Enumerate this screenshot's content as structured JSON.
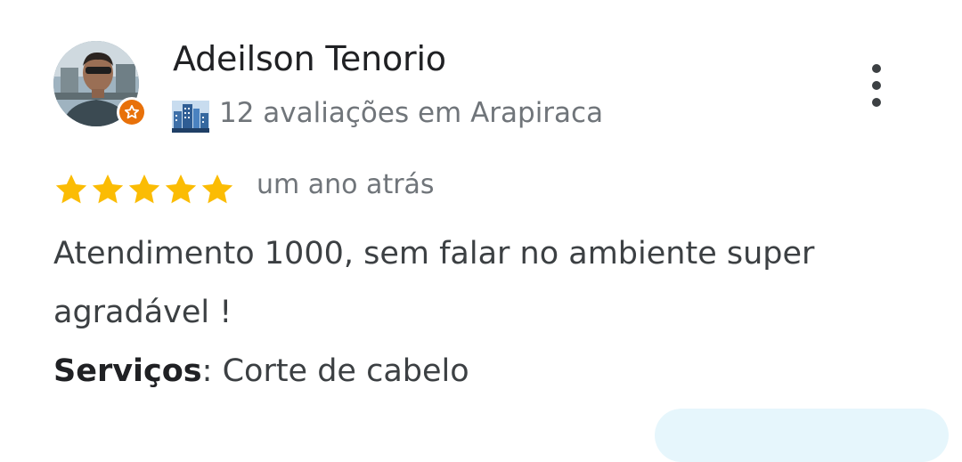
{
  "reviewer": {
    "name": "Adeilson Tenorio",
    "avatar_icon": "profile-photo",
    "badge_icon": "local-guide-star-icon",
    "badge_color": "#e8710a",
    "level_icon": "city-buildings-icon",
    "reviews_summary": "12 avaliações em Arapiraca"
  },
  "menu": {
    "icon": "more-vert-icon"
  },
  "review": {
    "rating": 5,
    "rating_max": 5,
    "star_color": "#fbbc04",
    "date": "um ano atrás",
    "text": "Atendimento 1000, sem falar no ambiente super agradável !"
  },
  "services": {
    "label": "Serviços",
    "separator": ":",
    "value": "Corte de cabelo"
  }
}
